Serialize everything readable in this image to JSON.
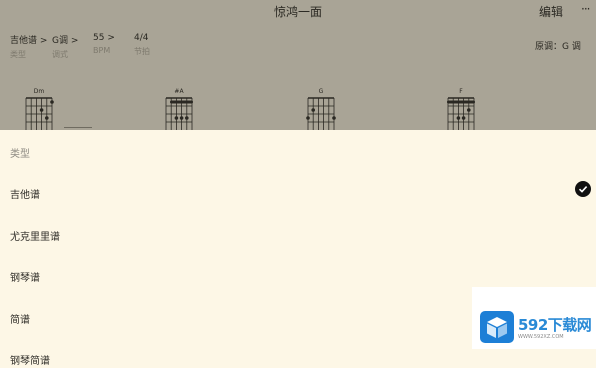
{
  "header": {
    "title": "惊鸿一面",
    "edit_label": "编辑",
    "more_label": "···"
  },
  "meta": [
    {
      "value": "吉他谱 >",
      "label": "类型"
    },
    {
      "value": "G调 >",
      "label": "调式"
    },
    {
      "value": "55 >",
      "label": "BPM"
    },
    {
      "value": "4/4",
      "label": "节拍"
    }
  ],
  "key_info": "原调：G 调",
  "chords": [
    "Dm",
    "#A",
    "G",
    "F"
  ],
  "sheet": {
    "title": "类型",
    "options": [
      "吉他谱",
      "尤克里里谱",
      "钢琴谱",
      "简谱",
      "钢琴简谱"
    ],
    "selected": "吉他谱"
  },
  "watermark": {
    "brand": "592下载网",
    "url": "WWW.592XZ.COM"
  }
}
